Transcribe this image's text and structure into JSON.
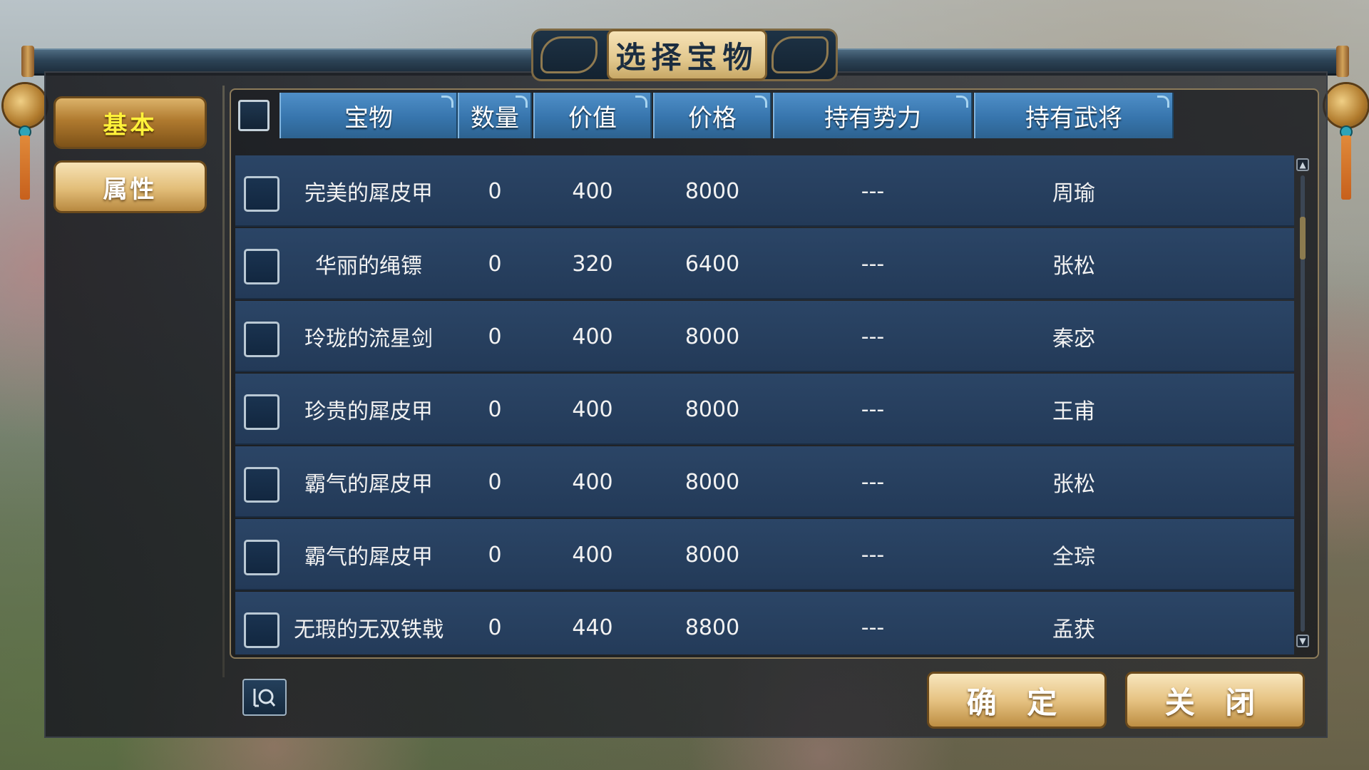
{
  "dialog": {
    "title": "选择宝物"
  },
  "sidebar": {
    "tabs": [
      {
        "label": "基本",
        "active": true
      },
      {
        "label": "属性",
        "active": false
      }
    ]
  },
  "table": {
    "columns": [
      "宝物",
      "数量",
      "价值",
      "价格",
      "持有势力",
      "持有武将"
    ],
    "rows": [
      {
        "item": "完美的犀皮甲",
        "qty": "0",
        "value": "400",
        "price": "8000",
        "faction": "---",
        "general": "周瑜"
      },
      {
        "item": "华丽的绳镖",
        "qty": "0",
        "value": "320",
        "price": "6400",
        "faction": "---",
        "general": "张松"
      },
      {
        "item": "玲珑的流星剑",
        "qty": "0",
        "value": "400",
        "price": "8000",
        "faction": "---",
        "general": "秦宓"
      },
      {
        "item": "珍贵的犀皮甲",
        "qty": "0",
        "value": "400",
        "price": "8000",
        "faction": "---",
        "general": "王甫"
      },
      {
        "item": "霸气的犀皮甲",
        "qty": "0",
        "value": "400",
        "price": "8000",
        "faction": "---",
        "general": "张松"
      },
      {
        "item": "霸气的犀皮甲",
        "qty": "0",
        "value": "400",
        "price": "8000",
        "faction": "---",
        "general": "全琮"
      },
      {
        "item": "无瑕的无双铁戟",
        "qty": "0",
        "value": "440",
        "price": "8800",
        "faction": "---",
        "general": "孟获"
      }
    ]
  },
  "footer": {
    "confirm_label": "确 定",
    "close_label": "关 闭"
  },
  "icons": {
    "search": "search-icon",
    "scroll_up": "chevron-up-icon",
    "scroll_down": "chevron-down-icon"
  },
  "colors": {
    "header_blue": "#3775ad",
    "row_blue": "#263f5f",
    "gold": "#e2bd78",
    "active_tab_text": "#fff23a"
  }
}
